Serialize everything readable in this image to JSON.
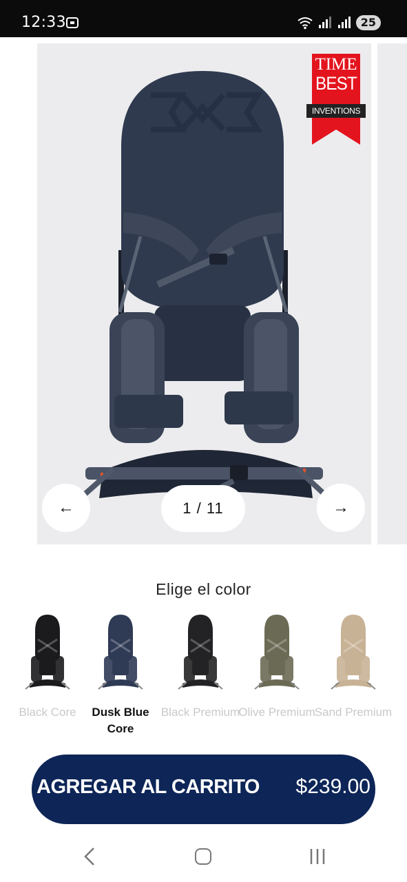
{
  "status_bar": {
    "time": "12:33",
    "battery": "25",
    "icons": [
      "screenshot-icon",
      "wifi-icon",
      "signal-icon",
      "signal-icon-2",
      "battery-icon"
    ]
  },
  "carousel": {
    "counter": "1 / 11",
    "prev_icon": "←",
    "next_icon": "→",
    "badge": {
      "line1": "TIME",
      "line2": "BEST",
      "line3": "INVENTIONS"
    }
  },
  "color_chooser": {
    "title": "Elige el color",
    "selected_index": 1,
    "options": [
      {
        "label": "Black Core",
        "color": "#1b1b1d"
      },
      {
        "label": "Dusk Blue Core",
        "color": "#2f3a55"
      },
      {
        "label": "Black Premium",
        "color": "#232325"
      },
      {
        "label": "Olive Premium",
        "color": "#6b6a54"
      },
      {
        "label": "Sand Premium",
        "color": "#c8b296"
      }
    ]
  },
  "cta": {
    "label": "AGREGAR AL CARRITO",
    "price": "$239.00",
    "color": "#0d2557"
  }
}
